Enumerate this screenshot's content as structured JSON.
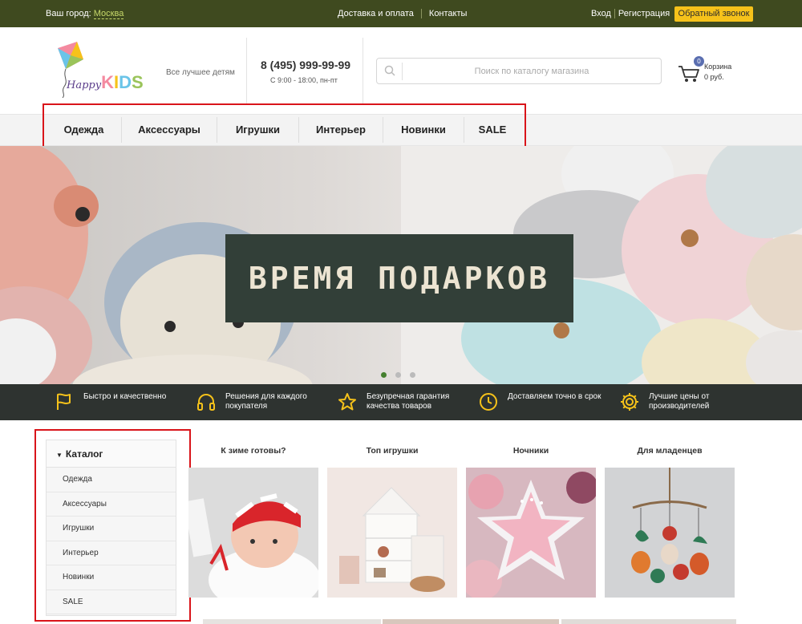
{
  "topbar": {
    "city_label": "Ваш город:",
    "city_value": "Москва",
    "nav": [
      "Доставка и оплата",
      "Контакты"
    ],
    "login": "Вход",
    "register": "Регистрация",
    "callback": "Обратный звонок"
  },
  "header": {
    "logo_happy": "Happy",
    "logo_kids": [
      "K",
      "I",
      "D",
      "S"
    ],
    "tagline": "Все лучшее детям",
    "phone": "8 (495) 999-99-99",
    "hours": "С 9:00 - 18:00, пн-пт",
    "search_placeholder": "Поиск по каталогу магазина",
    "cart_count": "0",
    "cart_label": "Корзина",
    "cart_sum": "0 руб."
  },
  "mainnav": [
    "Одежда",
    "Аксессуары",
    "Игрушки",
    "Интерьер",
    "Новинки",
    "SALE"
  ],
  "banner": {
    "title": "ВРЕМЯ ПОДАРКОВ",
    "slides": 3,
    "active_slide": 1
  },
  "features": [
    {
      "icon": "flag-icon",
      "text": "Быстро и качественно"
    },
    {
      "icon": "headphones-icon",
      "text": "Решения для каждого покупателя"
    },
    {
      "icon": "star-icon",
      "text": "Безупречная гарантия качества товаров"
    },
    {
      "icon": "clock-icon",
      "text": "Доставляем точно в срок"
    },
    {
      "icon": "gear-icon",
      "text": "Лучшие цены от производителей"
    }
  ],
  "sidebar": {
    "title": "Каталог",
    "items": [
      "Одежда",
      "Аксессуары",
      "Игрушки",
      "Интерьер",
      "Новинки",
      "SALE"
    ]
  },
  "categories": [
    {
      "title": "К зиме готовы?"
    },
    {
      "title": "Топ игрушки"
    },
    {
      "title": "Ночники"
    },
    {
      "title": "Для младенцев"
    }
  ],
  "colors": {
    "topbar_bg": "#3f4a1f",
    "accent_yellow": "#f6c21a",
    "features_bg": "#2e3330",
    "banner_box": "#323f38",
    "highlight": "#d9141a"
  }
}
